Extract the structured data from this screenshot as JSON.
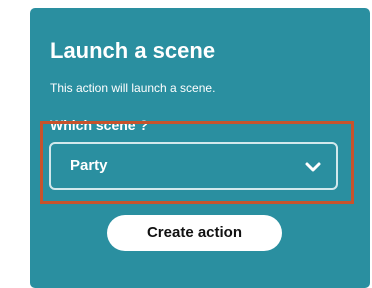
{
  "card": {
    "title": "Launch a scene",
    "description": "This action will launch a scene.",
    "background_color": "#2a8fa0"
  },
  "scene_field": {
    "label": "Which scene ?",
    "selected_value": "Party",
    "chevron_icon": "chevron-down-icon",
    "highlight_color": "#c7532c"
  },
  "actions": {
    "create_label": "Create action"
  }
}
